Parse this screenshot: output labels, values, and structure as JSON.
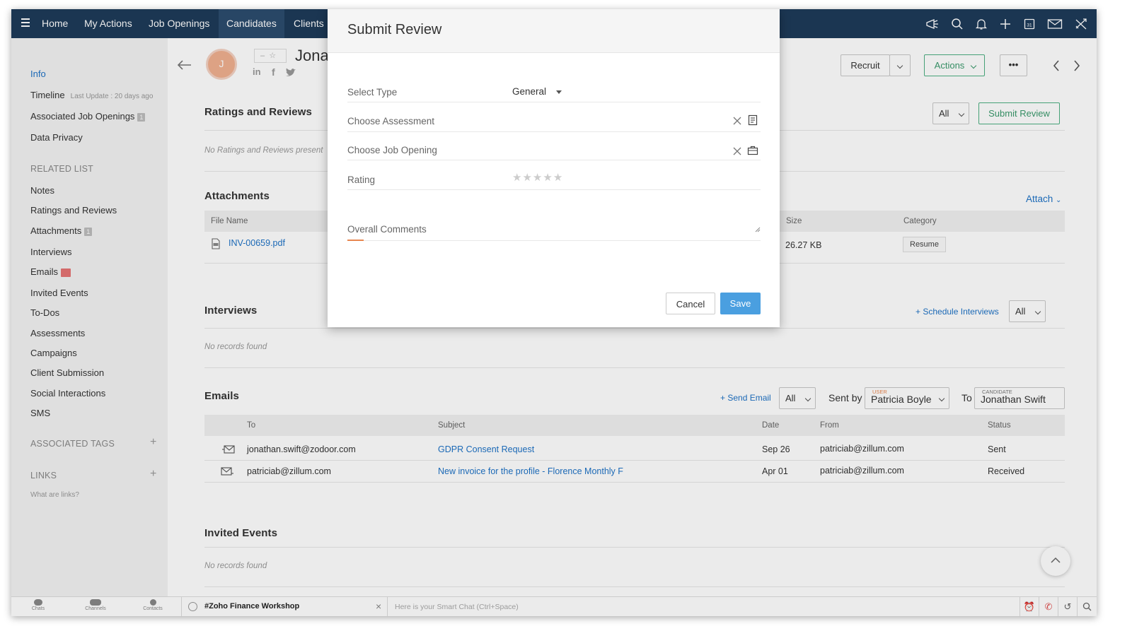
{
  "nav": {
    "tabs": [
      "Home",
      "My Actions",
      "Job Openings",
      "Candidates",
      "Clients"
    ],
    "active_tab": "Candidates",
    "icons": [
      "announce-icon",
      "search-icon",
      "bell-icon",
      "plus-icon",
      "calendar-icon",
      "mail-icon",
      "tools-icon"
    ]
  },
  "sidebar": {
    "info": "Info",
    "timeline": "Timeline",
    "timeline_update": "Last Update : 20 days ago",
    "associated_jobs": "Associated Job Openings",
    "associated_jobs_count": "1",
    "data_privacy": "Data Privacy",
    "related_list_head": "RELATED LIST",
    "related": [
      "Notes",
      "Ratings and Reviews",
      "Attachments",
      "Interviews",
      "Emails",
      "Invited Events",
      "To-Dos",
      "Assessments",
      "Campaigns",
      "Client Submission",
      "Social Interactions",
      "SMS"
    ],
    "attachments_count": "1",
    "associated_tags_head": "ASSOCIATED TAGS",
    "links_head": "LINKS",
    "links_help": "What are links?"
  },
  "record": {
    "name_partial": "Jona",
    "avatar_initial": "J",
    "recruit_label": "Recruit",
    "actions_label": "Actions",
    "more_label": "•••"
  },
  "ratings": {
    "title": "Ratings and Reviews",
    "empty": "No Ratings and Reviews present",
    "filter": "All",
    "submit_label": "Submit Review"
  },
  "attachments": {
    "title": "Attachments",
    "attach_label": "Attach",
    "headers": [
      "File Name",
      "Size",
      "Category"
    ],
    "rows": [
      {
        "file": "INV-00659.pdf",
        "size": "26.27 KB",
        "category": "Resume"
      }
    ]
  },
  "interviews": {
    "title": "Interviews",
    "schedule_label": "Schedule Interviews",
    "filter": "All",
    "empty": "No records found"
  },
  "emails": {
    "title": "Emails",
    "send_label": "Send Email",
    "filter": "All",
    "sent_by_label": "Sent by",
    "user_tag": "USER",
    "user_value": "Patricia Boyle",
    "to_label": "To",
    "candidate_tag": "CANDIDATE",
    "candidate_value": "Jonathan Swift",
    "headers": [
      "To",
      "Subject",
      "Date",
      "From",
      "Status"
    ],
    "rows": [
      {
        "to": "jonathan.swift@zodoor.com",
        "subject": "GDPR Consent Request",
        "date": "Sep 26",
        "from": "patriciab@zillum.com",
        "status": "Sent"
      },
      {
        "to": "patriciab@zillum.com",
        "subject": "New invoice for the profile - Florence Monthly F",
        "date": "Apr 01",
        "from": "patriciab@zillum.com",
        "status": "Received"
      }
    ]
  },
  "invited_events": {
    "title": "Invited Events",
    "empty": "No records found"
  },
  "bottombar": {
    "chats": "Chats",
    "channels": "Channels",
    "contacts": "Contacts",
    "channel_name": "#Zoho Finance Workshop",
    "smart_chat_placeholder": "Here is your Smart Chat (Ctrl+Space)"
  },
  "modal": {
    "title": "Submit Review",
    "select_type_label": "Select Type",
    "select_type_value": "General",
    "assessment_label": "Choose Assessment",
    "job_opening_label": "Choose Job Opening",
    "rating_label": "Rating",
    "rating_value": 0,
    "rating_max": 5,
    "comments_label": "Overall Comments",
    "cancel_label": "Cancel",
    "save_label": "Save"
  },
  "colors": {
    "nav_bg": "#1e3b5a",
    "link": "#1e72c6",
    "green": "#3a9a6c",
    "save_bg": "#4a9fe0",
    "accent_underline": "#e8864f"
  }
}
